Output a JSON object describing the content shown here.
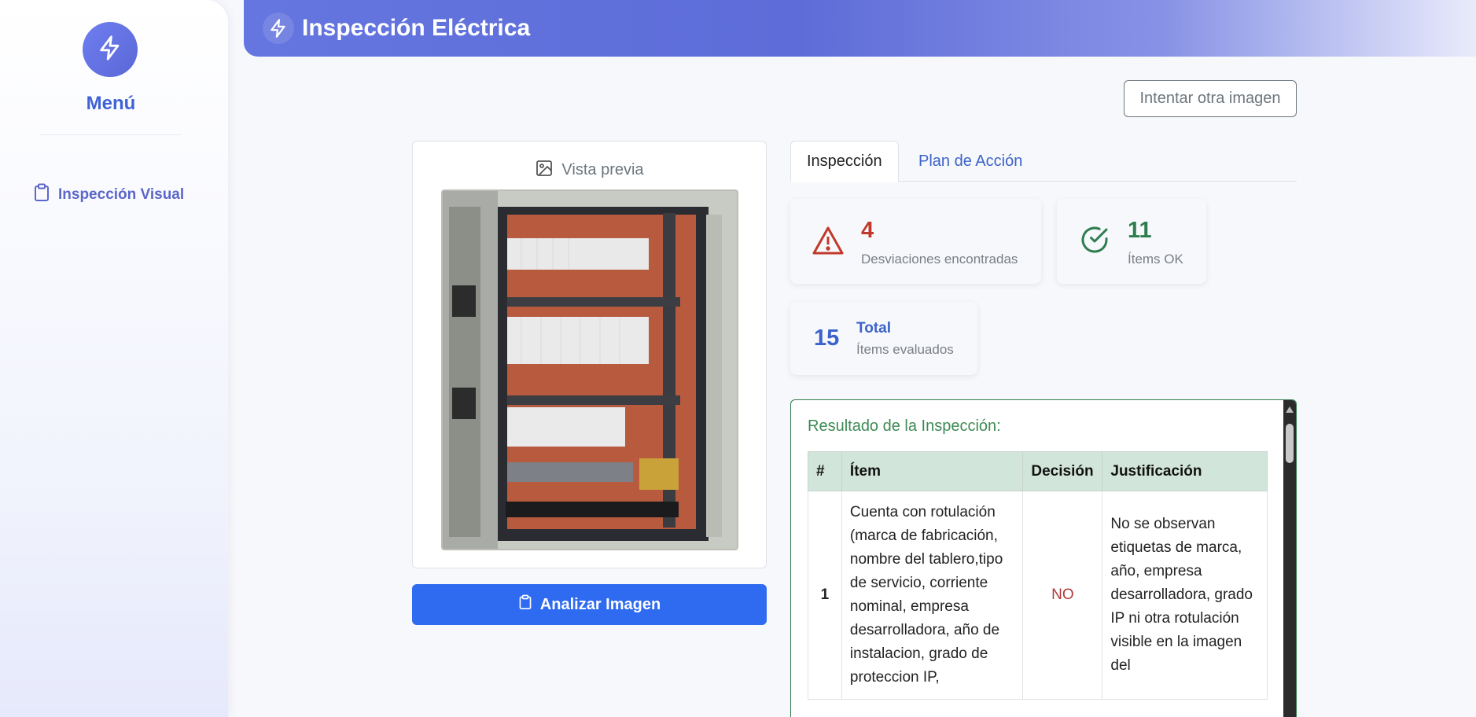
{
  "sidebar": {
    "menu_label": "Menú",
    "items": [
      {
        "label": "Inspección Visual",
        "icon": "clipboard-icon"
      }
    ]
  },
  "header": {
    "title": "Inspección Eléctrica",
    "icon": "lightning-icon"
  },
  "actions": {
    "retry_label": "Intentar otra imagen",
    "analyze_label": "Analizar Imagen"
  },
  "preview": {
    "label": "Vista previa",
    "icon": "image-icon"
  },
  "tabs": [
    {
      "label": "Inspección",
      "active": true
    },
    {
      "label": "Plan de Acción",
      "active": false
    }
  ],
  "stats": {
    "deviations": {
      "value": "4",
      "label": "Desviaciones encontradas",
      "color": "#c0392b"
    },
    "ok": {
      "value": "11",
      "label": "Ítems OK",
      "color": "#2e7d4f"
    },
    "total": {
      "value": "15",
      "title": "Total",
      "label": "Ítems evaluados",
      "color": "#3b63c9"
    }
  },
  "results": {
    "title": "Resultado de la Inspección:",
    "columns": [
      "#",
      "Ítem",
      "Decisión",
      "Justificación"
    ],
    "rows": [
      {
        "index": "1",
        "item": "Cuenta con rotulación (marca de fabricación, nombre del tablero,tipo de servicio, corriente nominal, empresa desarrolladora, año de instalacion, grado de proteccion IP,",
        "decision": "NO",
        "justification": "No se observan etiquetas de marca, año, empresa desarrolladora, grado IP ni otra rotulación visible en la imagen del"
      }
    ]
  }
}
